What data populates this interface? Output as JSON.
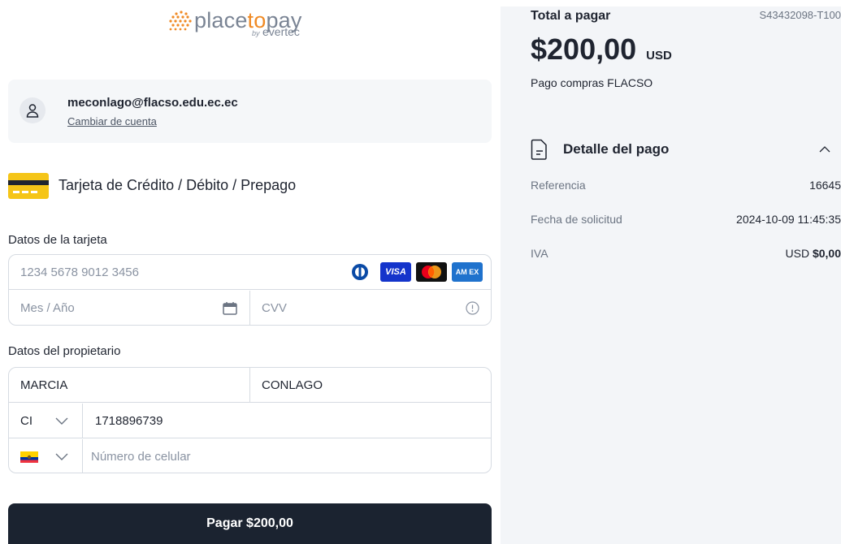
{
  "brand": {
    "name_part1": "place",
    "name_part2": "to",
    "name_part3": "pay",
    "by": "by",
    "partner": "evertec",
    "accent": "#f08a24"
  },
  "account": {
    "email": "meconlago@flacso.edu.ec.ec",
    "change_label": "Cambiar de cuenta",
    "icon": "user-icon"
  },
  "method": {
    "icon": "credit-card-icon",
    "label": "Tarjeta de Crédito / Débito / Prepago"
  },
  "card": {
    "section_title": "Datos de la tarjeta",
    "number_placeholder": "1234 5678 9012 3456",
    "expiry_placeholder": "Mes / Año",
    "cvv_placeholder": "CVV",
    "brands": [
      "diners-icon",
      "visa-icon",
      "mastercard-icon",
      "amex-icon"
    ],
    "visa_text": "VISA",
    "amex_text": "AM EX"
  },
  "owner": {
    "section_title": "Datos del propietario",
    "first_name": "MARCIA",
    "last_name": "CONLAGO",
    "doc_type": "CI",
    "doc_number": "1718896739",
    "phone_country_flag": "ecuador-flag-icon",
    "phone_placeholder": "Número de celular"
  },
  "pay_button": "Pagar $200,00",
  "summary": {
    "total_label": "Total a pagar",
    "reference_code": "S43432098-T100",
    "amount": "$200,00",
    "currency": "USD",
    "description": "Pago compras FLACSO",
    "detail_title": "Detalle del pago",
    "rows": [
      {
        "key": "Referencia",
        "value": "16645"
      },
      {
        "key": "Fecha de solicitud",
        "value": "2024-10-09 11:45:35"
      },
      {
        "key": "IVA",
        "value_prefix": "USD ",
        "value": "$0,00"
      }
    ]
  }
}
